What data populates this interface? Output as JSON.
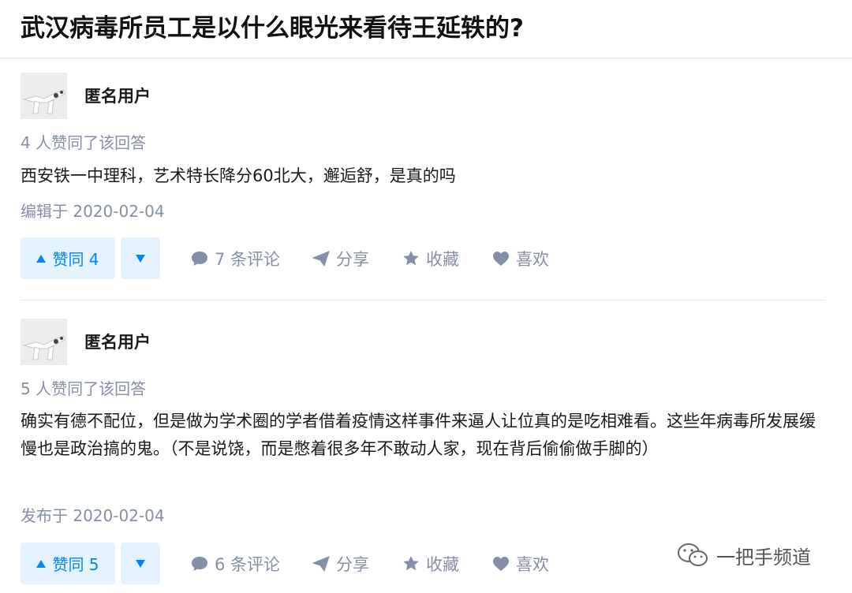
{
  "question": {
    "title": "武汉病毒所员工是以什么眼光来看待王延轶的?"
  },
  "answers": [
    {
      "author": "匿名用户",
      "votes_text": "4 人赞同了该回答",
      "content": "西安铁一中理科，艺术特长降分60北大，邂逅舒，是真的吗",
      "date_text": "编辑于 2020-02-04",
      "upvote_label": "赞同 4",
      "comments_label": "7 条评论",
      "share_label": "分享",
      "favorite_label": "收藏",
      "like_label": "喜欢"
    },
    {
      "author": "匿名用户",
      "votes_text": "5 人赞同了该回答",
      "content": "确实有德不配位，但是做为学术圈的学者借着疫情这样事件来逼人让位真的是吃相难看。这些年病毒所发展缓慢也是政治搞的鬼。（不是说饶，而是憋着很多年不敢动人家，现在背后偷偷做手脚的）",
      "date_text": "发布于 2020-02-04",
      "upvote_label": "赞同 5",
      "comments_label": "6 条评论",
      "share_label": "分享",
      "favorite_label": "收藏",
      "like_label": "喜欢"
    }
  ],
  "watermark": {
    "text": "一把手频道"
  },
  "colors": {
    "accent": "#0084ff",
    "accent_bg": "#e5f2ff",
    "meta": "#8590a6"
  }
}
